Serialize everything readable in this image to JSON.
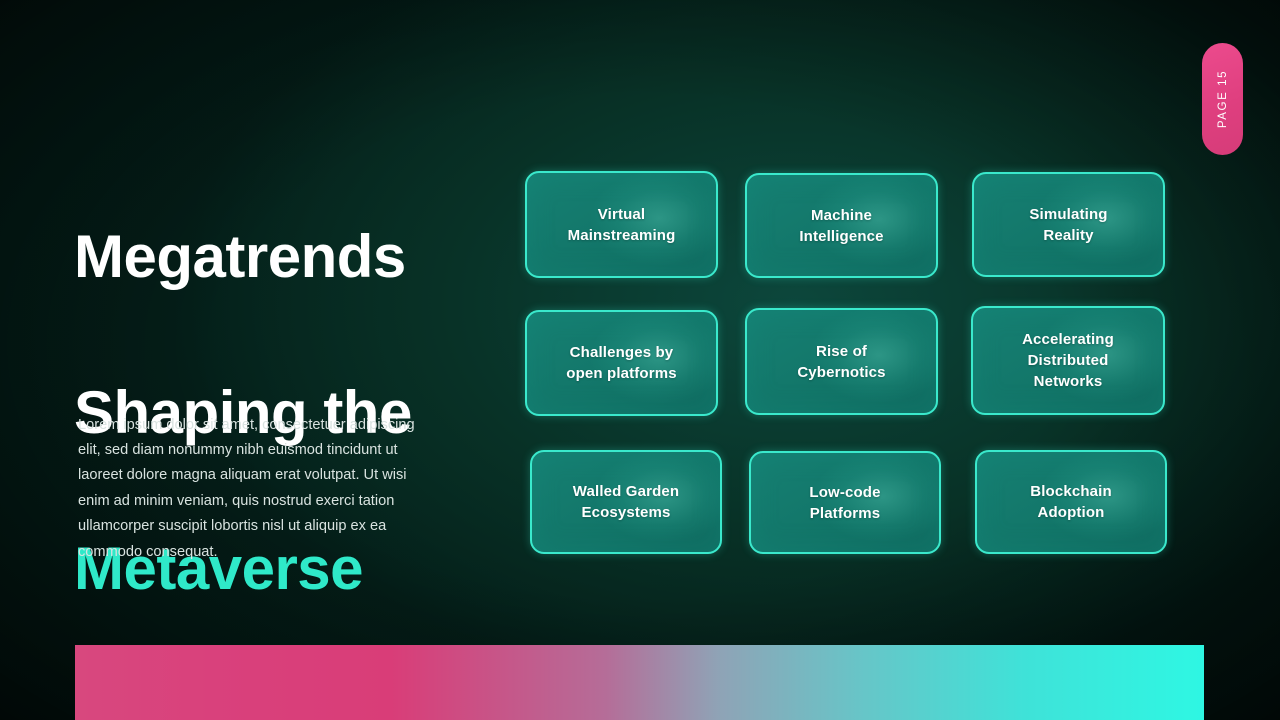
{
  "slide": {
    "background_color": "#04201b",
    "glow_color": "#0c473c"
  },
  "headline": {
    "line1": "Megatrends",
    "line2": "Shaping the",
    "accent_line": "Metaverse",
    "accent_color": "#2fe9c9"
  },
  "body": {
    "paragraph": "Lorem ipsum dolor sit amet, consectetuer adipiscing elit, sed diam nonummy nibh euismod tincidunt ut laoreet dolore magna aliquam erat volutpat. Ut wisi enim ad minim veniam, quis nostrud exerci tation ullamcorper suscipit lobortis nisl ut aliquip ex ea commodo consequat."
  },
  "page_badge": {
    "label": "PAGE 15",
    "color": "#e8498a"
  },
  "cards": {
    "border_color": "#3ae9cc",
    "fill_color": "#13786d",
    "items": [
      {
        "label": "Virtual\nMainstreaming"
      },
      {
        "label": "Machine\nIntelligence"
      },
      {
        "label": "Simulating\nReality"
      },
      {
        "label": "Challenges by\nopen platforms"
      },
      {
        "label": "Rise of\nCybernotics"
      },
      {
        "label": "Accelerating\nDistributed\nNetworks"
      },
      {
        "label": "Walled Garden\nEcosystems"
      },
      {
        "label": "Low-code\nPlatforms"
      },
      {
        "label": "Blockchain\nAdoption"
      }
    ]
  },
  "bottom_bar": {
    "gradient_from": "#d8487e",
    "gradient_to": "#2ef7e3"
  }
}
